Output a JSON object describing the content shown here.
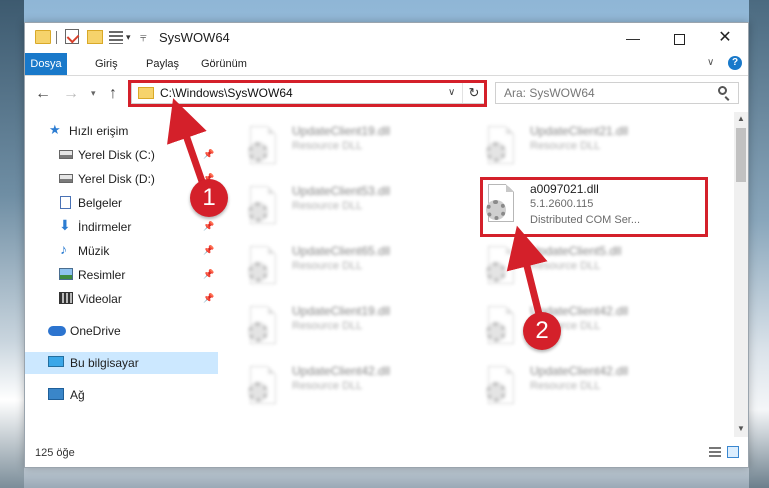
{
  "window": {
    "title": "SysWOW64",
    "minimize": "—",
    "maximize": "",
    "close": "✕"
  },
  "ribbon": {
    "tabs": [
      "Dosya",
      "Giriş",
      "Paylaş",
      "Görünüm"
    ],
    "help": "?"
  },
  "navigation": {
    "address": "C:\\Windows\\SysWOW64",
    "search_placeholder": "Ara: SysWOW64",
    "refresh": "↻"
  },
  "sidebar": {
    "items": [
      {
        "label": "Hızlı erişim",
        "icon": "star-icon",
        "pinned": false
      },
      {
        "label": "Yerel Disk (C:)",
        "icon": "drive-icon",
        "pinned": true
      },
      {
        "label": "Yerel Disk (D:)",
        "icon": "drive-icon",
        "pinned": true
      },
      {
        "label": "Belgeler",
        "icon": "documents-icon",
        "pinned": true
      },
      {
        "label": "İndirmeler",
        "icon": "downloads-icon",
        "pinned": true
      },
      {
        "label": "Müzik",
        "icon": "music-icon",
        "pinned": true
      },
      {
        "label": "Resimler",
        "icon": "pictures-icon",
        "pinned": true
      },
      {
        "label": "Videolar",
        "icon": "videos-icon",
        "pinned": true
      },
      {
        "label": "OneDrive",
        "icon": "cloud-icon",
        "pinned": false
      },
      {
        "label": "Bu bilgisayar",
        "icon": "computer-icon",
        "pinned": false,
        "selected": true
      },
      {
        "label": "Ağ",
        "icon": "network-icon",
        "pinned": false
      }
    ]
  },
  "files": {
    "left_column": [
      {
        "name": "UpdateClient19.dll",
        "type": "Resource DLL"
      },
      {
        "name": "UpdateClient53.dll",
        "type": "Resource DLL"
      },
      {
        "name": "UpdateClient65.dll",
        "type": "Resource DLL"
      },
      {
        "name": "UpdateClient19.dll",
        "type": "Resource DLL"
      },
      {
        "name": "UpdateClient42.dll",
        "type": "Resource DLL"
      }
    ],
    "right_column": [
      {
        "name": "UpdateClient21.dll",
        "type": "Resource DLL"
      },
      {
        "name": "UpdateClient5.dll",
        "type": "Resource DLL"
      },
      {
        "name": "UpdateClient42.dll",
        "type": "Resource DLL"
      },
      {
        "name": "UpdateClient42.dll",
        "type": "Resource DLL"
      }
    ],
    "highlighted": {
      "name": "a0097021.dll",
      "version": "5.1.2600.115",
      "description": "Distributed COM Ser..."
    }
  },
  "status": {
    "item_count": "125 öğe"
  },
  "annotations": {
    "badge1": "1",
    "badge2": "2",
    "color": "#d4202a"
  }
}
